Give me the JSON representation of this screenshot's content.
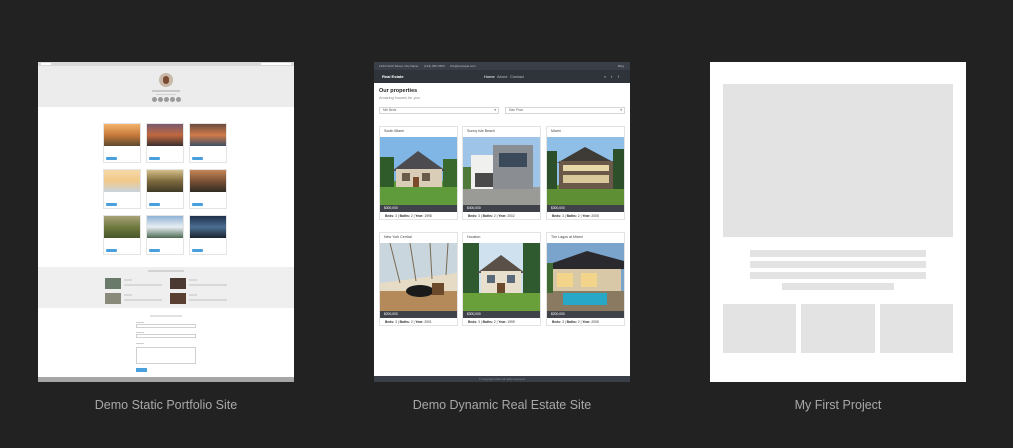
{
  "projects": [
    {
      "caption": "Demo Static Portfolio Site"
    },
    {
      "caption": "Demo Dynamic Real Estate Site"
    },
    {
      "caption": "My First Project"
    }
  ],
  "real_estate": {
    "topbar": {
      "address": "1234 North Street, City Name",
      "phone": "(123) 456-7890",
      "email": "info@example.com",
      "right": "Blog"
    },
    "nav": {
      "brand": "Real Estate",
      "links": [
        "Home",
        "About",
        "Contact"
      ],
      "icons": [
        "search-icon",
        "twitter-icon",
        "facebook-icon"
      ]
    },
    "heading": "Our properties",
    "subheading": "Amazing houses for you",
    "filters": [
      "Min Beds",
      "Max Price"
    ],
    "listings": [
      {
        "city": "South Miami",
        "price": "$300,000",
        "beds": "3",
        "baths": "2",
        "year": "1998"
      },
      {
        "city": "Sunny Isle Beach",
        "price": "$400,000",
        "beds": "3",
        "baths": "2",
        "year": "2002"
      },
      {
        "city": "Miami",
        "price": "$300,000",
        "beds": "3",
        "baths": "2",
        "year": "2005"
      },
      {
        "city": "New York Central",
        "price": "$200,000",
        "beds": "3",
        "baths": "2",
        "year": "2001"
      },
      {
        "city": "Houston",
        "price": "$300,000",
        "beds": "3",
        "baths": "2",
        "year": "1999"
      },
      {
        "city": "The Lagos at Miami",
        "price": "$200,000",
        "beds": "3",
        "baths": "2",
        "year": "2005"
      }
    ],
    "spec_labels": {
      "beds": "Beds:",
      "baths": "Baths:",
      "year": "Year:"
    },
    "footer": "© Copyright 2019. All rights reserved."
  }
}
